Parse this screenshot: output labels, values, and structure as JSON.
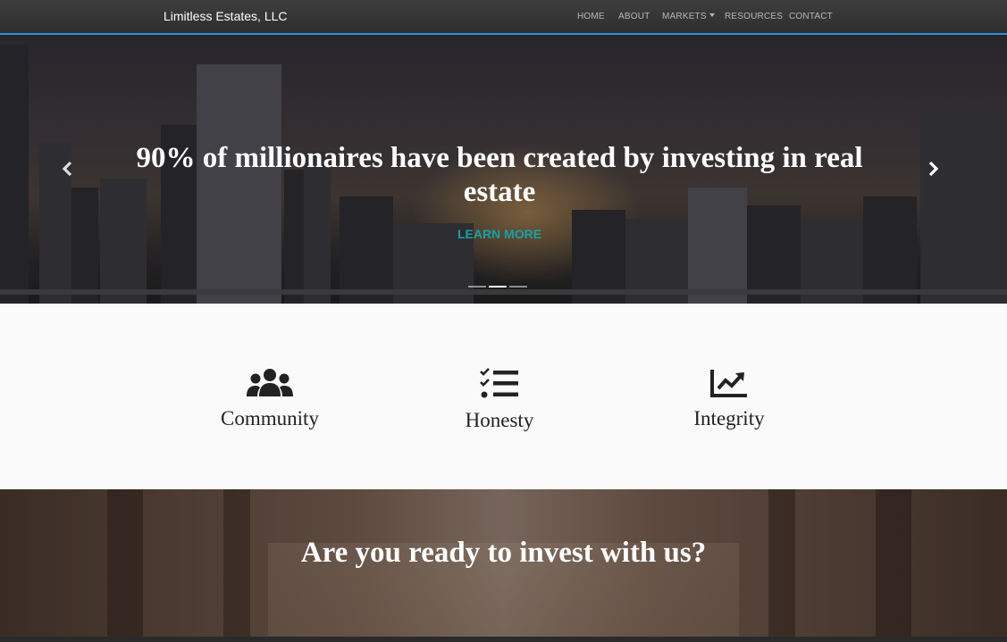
{
  "navbar": {
    "brand": "Limitless Estates, LLC",
    "items": [
      {
        "label": "HOME"
      },
      {
        "label": "ABOUT"
      },
      {
        "label": "MARKETS"
      },
      {
        "label": "RESOURCES"
      },
      {
        "label": "CONTACT"
      }
    ],
    "accent_color": "#2f8fd6"
  },
  "hero": {
    "title": "90% of millionaires have been created by investing in real estate",
    "cta_label": "LEARN MORE",
    "cta_color": "#17a2a4",
    "prev_icon": "chevron-left-icon",
    "next_icon": "chevron-right-icon",
    "slides_count": 3,
    "active_slide": 2
  },
  "values": [
    {
      "label": "Community",
      "icon": "users-icon"
    },
    {
      "label": "Honesty",
      "icon": "tasks-icon"
    },
    {
      "label": "Integrity",
      "icon": "chart-line-icon"
    }
  ],
  "cta": {
    "title": "Are you ready to invest with us?"
  }
}
